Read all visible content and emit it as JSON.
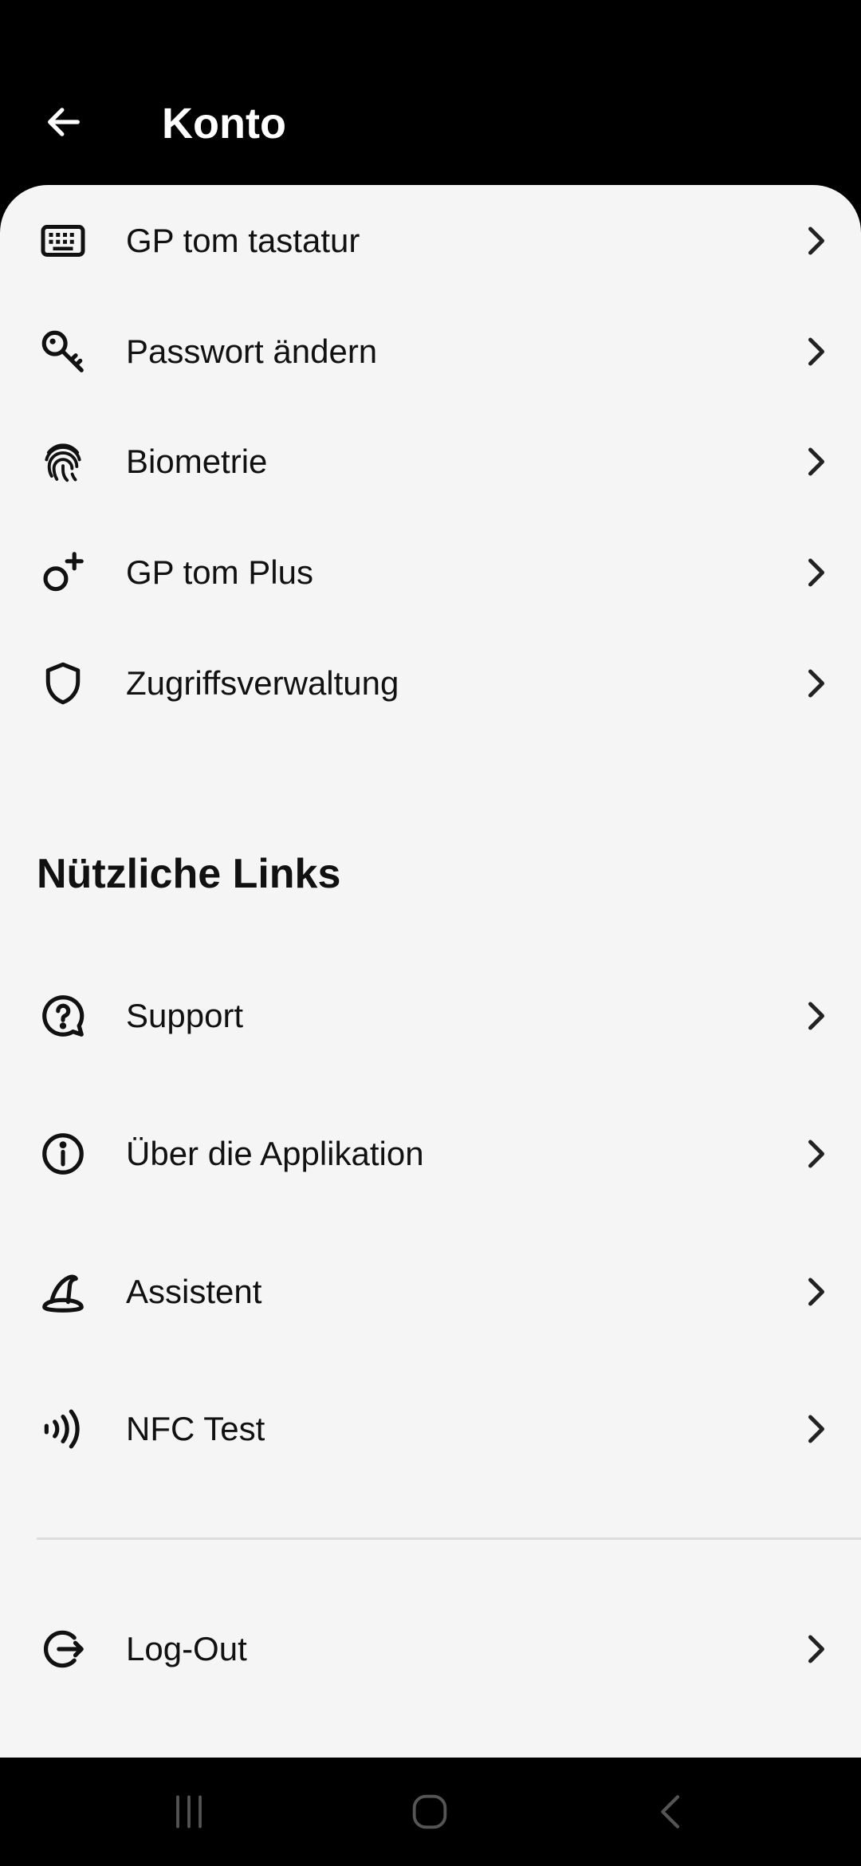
{
  "header": {
    "title": "Konto"
  },
  "account_items": [
    {
      "label": "GP tom tastatur",
      "icon": "keyboard-icon"
    },
    {
      "label": "Passwort ändern",
      "icon": "key-icon"
    },
    {
      "label": "Biometrie",
      "icon": "fingerprint-icon"
    },
    {
      "label": "GP tom Plus",
      "icon": "person-add-icon"
    },
    {
      "label": "Zugriffsverwaltung",
      "icon": "shield-icon"
    }
  ],
  "links_section": {
    "title": "Nützliche Links"
  },
  "link_items": [
    {
      "label": "Support",
      "icon": "help-icon"
    },
    {
      "label": "Über die Applikation",
      "icon": "info-icon"
    },
    {
      "label": "Assistent",
      "icon": "wizard-hat-icon"
    },
    {
      "label": "NFC Test",
      "icon": "nfc-icon"
    }
  ],
  "logout": {
    "label": "Log-Out",
    "icon": "logout-icon"
  },
  "system_nav": {
    "buttons": [
      "recent-apps-icon",
      "home-icon",
      "back-icon"
    ]
  }
}
